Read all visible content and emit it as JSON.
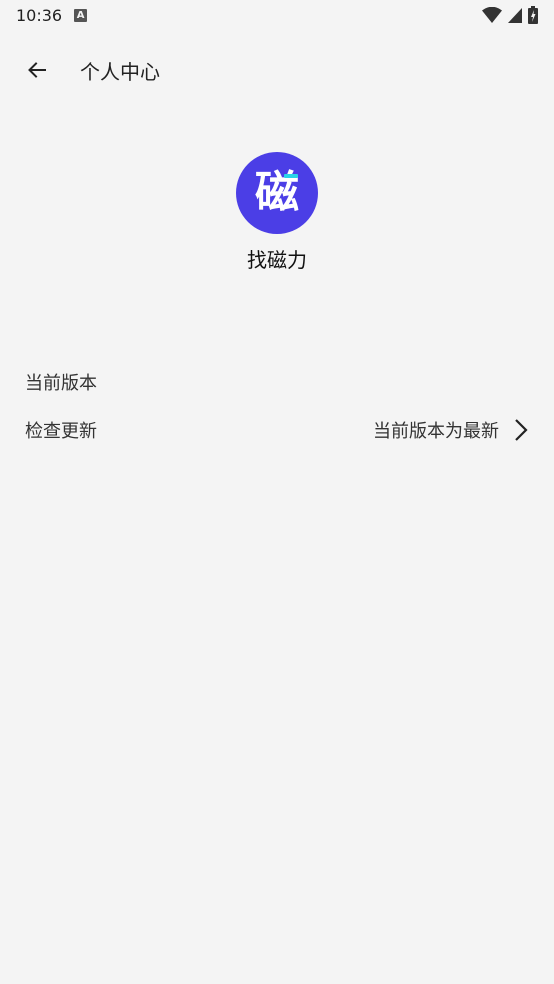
{
  "status_bar": {
    "time": "10:36",
    "notification_icon_letter": "A"
  },
  "app_bar": {
    "title": "个人中心"
  },
  "profile": {
    "logo_glyph": "磁",
    "logo_color": "#4b3ee6",
    "app_name": "找磁力"
  },
  "settings": {
    "version_label": "当前版本",
    "update_label": "检查更新",
    "update_status": "当前版本为最新"
  }
}
